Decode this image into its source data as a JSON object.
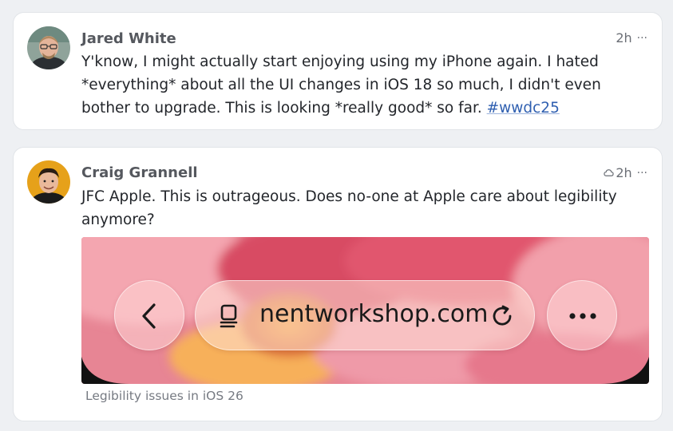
{
  "posts": [
    {
      "author": "Jared White",
      "time": "2h",
      "more": "···",
      "text": "Y'know, I might actually start enjoying using my iPhone again. I hated *everything* about all the UI changes in iOS 18 so much, I didn't even bother to upgrade. This is looking *really good* so far. ",
      "hashtag": "#wwdc25",
      "icons": [
        "avatar"
      ]
    },
    {
      "author": "Craig Grannell",
      "time": "2h",
      "more": "···",
      "text": "JFC Apple. This is outrageous. Does no-one at Apple care about legibility anymore?",
      "media": {
        "url_text": "nentworkshop.com",
        "icons": [
          "back-chevron-icon",
          "reader-icon",
          "reload-icon",
          "more-dots-icon"
        ]
      },
      "caption": "Legibility issues in iOS 26",
      "icons": [
        "cloud-edited-icon",
        "avatar"
      ]
    }
  ],
  "colors": {
    "background": "#eef0f3",
    "card": "#ffffff",
    "hashtag": "#2f5fb0",
    "media_pink": "#e27f8e"
  }
}
